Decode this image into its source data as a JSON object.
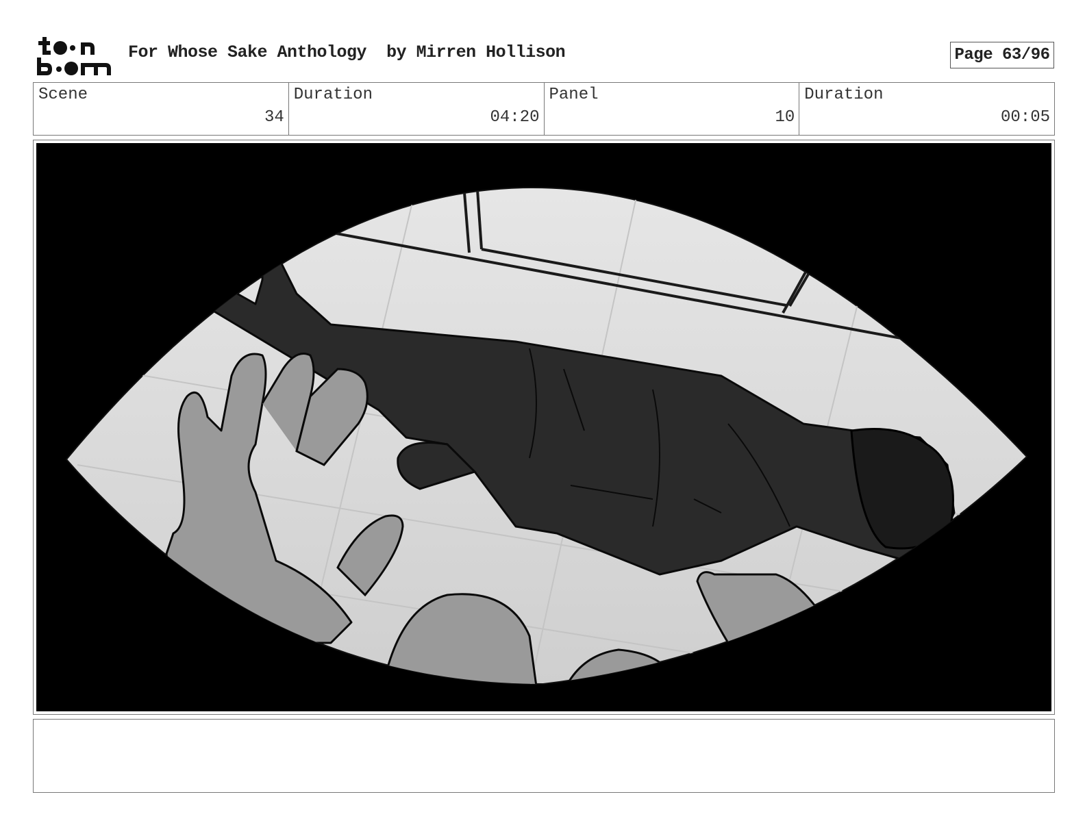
{
  "header": {
    "logo_line1": "toon",
    "logo_line2": "boom",
    "title": "For Whose Sake Anthology  by Mirren Hollison",
    "page": "Page 63/96"
  },
  "info": {
    "scene_label": "Scene",
    "scene_value": "34",
    "scene_duration_label": "Duration",
    "scene_duration_value": "04:20",
    "panel_label": "Panel",
    "panel_value": "10",
    "panel_duration_label": "Duration",
    "panel_duration_value": "00:05"
  },
  "notes": {
    "text": ""
  }
}
